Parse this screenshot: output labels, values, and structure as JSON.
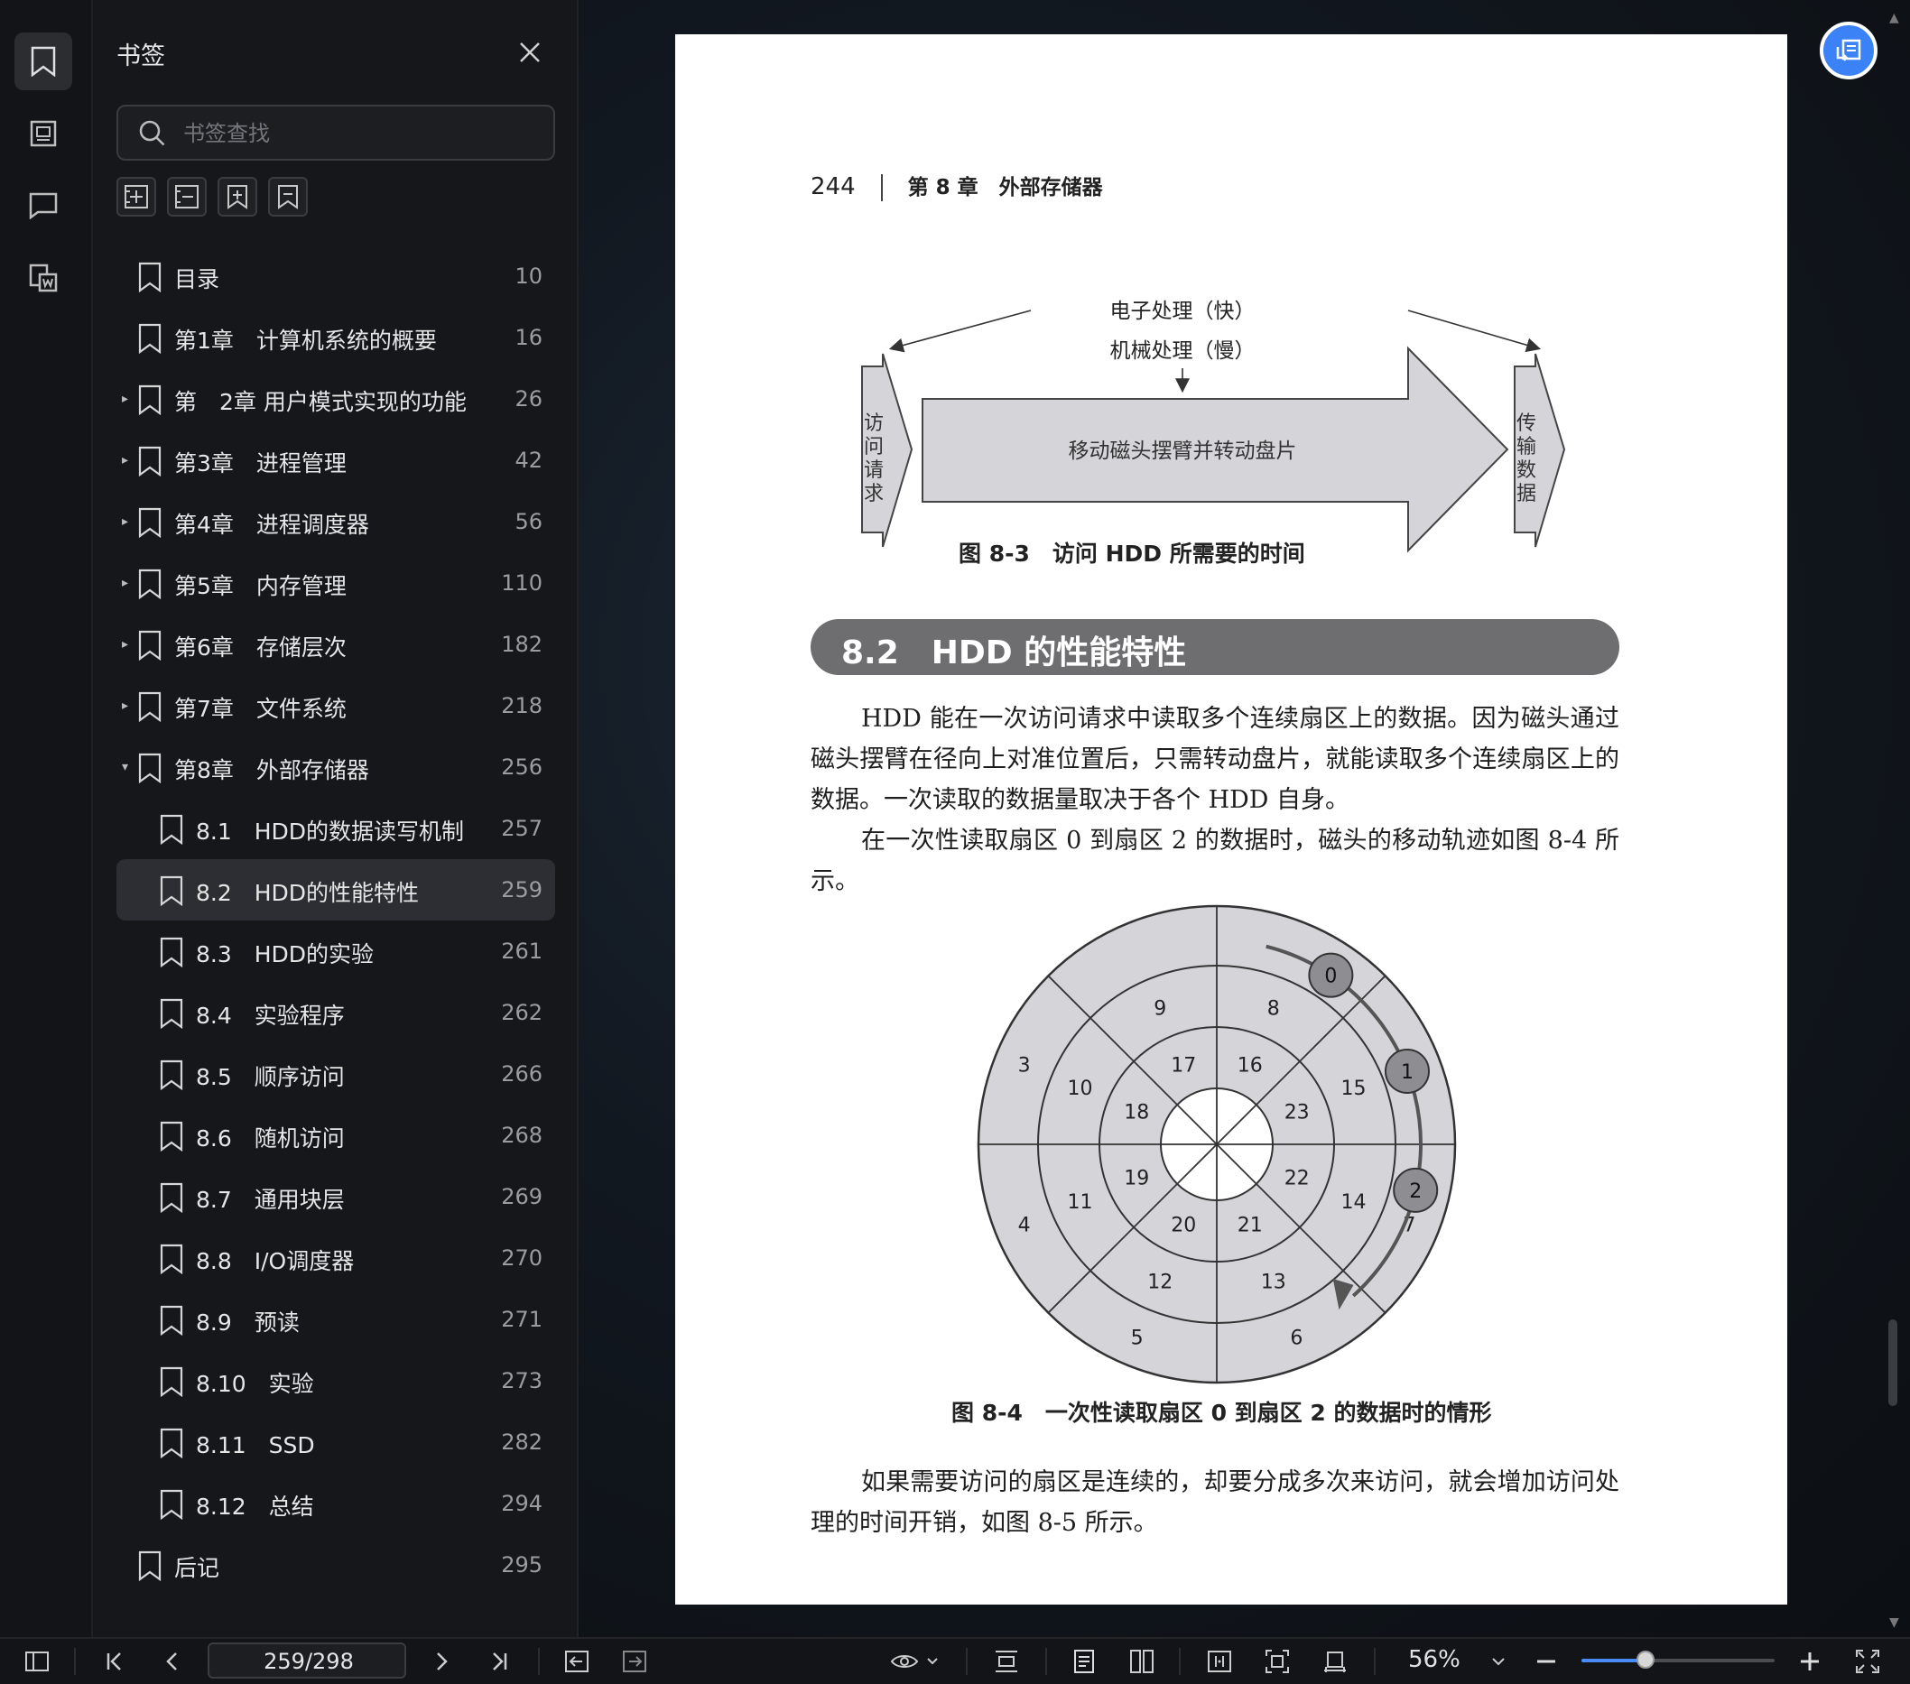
{
  "panel": {
    "title": "书签",
    "search_placeholder": "书签查找"
  },
  "bookmarks": [
    {
      "label": "目录",
      "page": "10",
      "level": 0,
      "arrow": ""
    },
    {
      "label": "第1章　计算机系统的概要",
      "page": "16",
      "level": 0,
      "arrow": ""
    },
    {
      "label": "第　2章 用户模式实现的功能",
      "page": "26",
      "level": 0,
      "arrow": "▸"
    },
    {
      "label": "第3章　进程管理",
      "page": "42",
      "level": 0,
      "arrow": "▸"
    },
    {
      "label": "第4章　进程调度器",
      "page": "56",
      "level": 0,
      "arrow": "▸"
    },
    {
      "label": "第5章　内存管理",
      "page": "110",
      "level": 0,
      "arrow": "▸"
    },
    {
      "label": "第6章　存储层次",
      "page": "182",
      "level": 0,
      "arrow": "▸"
    },
    {
      "label": "第7章　文件系统",
      "page": "218",
      "level": 0,
      "arrow": "▸"
    },
    {
      "label": "第8章　外部存储器",
      "page": "256",
      "level": 0,
      "arrow": "▾"
    },
    {
      "label": "8.1　HDD的数据读写机制",
      "page": "257",
      "level": 1,
      "arrow": ""
    },
    {
      "label": "8.2　HDD的性能特性",
      "page": "259",
      "level": 1,
      "arrow": "",
      "selected": true
    },
    {
      "label": "8.3　HDD的实验",
      "page": "261",
      "level": 1,
      "arrow": ""
    },
    {
      "label": "8.4　实验程序",
      "page": "262",
      "level": 1,
      "arrow": ""
    },
    {
      "label": "8.5　顺序访问",
      "page": "266",
      "level": 1,
      "arrow": ""
    },
    {
      "label": "8.6　随机访问",
      "page": "268",
      "level": 1,
      "arrow": ""
    },
    {
      "label": "8.7　通用块层",
      "page": "269",
      "level": 1,
      "arrow": ""
    },
    {
      "label": "8.8　I/O调度器",
      "page": "270",
      "level": 1,
      "arrow": ""
    },
    {
      "label": "8.9　预读",
      "page": "271",
      "level": 1,
      "arrow": ""
    },
    {
      "label": "8.10　实验",
      "page": "273",
      "level": 1,
      "arrow": ""
    },
    {
      "label": "8.11　SSD",
      "page": "282",
      "level": 1,
      "arrow": ""
    },
    {
      "label": "8.12　总结",
      "page": "294",
      "level": 1,
      "arrow": ""
    },
    {
      "label": "后记",
      "page": "295",
      "level": 0,
      "arrow": ""
    }
  ],
  "page": {
    "number": "244",
    "chapter": "第 8 章　外部存储器",
    "fig3": {
      "top_label": "电子处理（快）",
      "mid_label": "机械处理（慢）",
      "left_label": "访问请求",
      "center_label": "移动磁头摆臂并转动盘片",
      "right_label": "传输数据",
      "caption": "图 8-3　访问 HDD 所需要的时间"
    },
    "section": "8.2　HDD 的性能特性",
    "para1": "HDD 能在一次访问请求中读取多个连续扇区上的数据。因为磁头通过磁头摆臂在径向上对准位置后，只需转动盘片，就能读取多个连续扇区上的数据。一次读取的数据量取决于各个 HDD 自身。",
    "para2": "在一次性读取扇区 0 到扇区 2 的数据时，磁头的移动轨迹如图 8-4 所示。",
    "fig4": {
      "sectors": [
        "0",
        "1",
        "2",
        "3",
        "4",
        "5",
        "6",
        "7",
        "8",
        "9",
        "10",
        "11",
        "12",
        "13",
        "14",
        "15",
        "16",
        "17",
        "18",
        "19",
        "20",
        "21",
        "22",
        "23"
      ],
      "caption": "图 8-4　一次性读取扇区 0 到扇区 2 的数据时的情形"
    },
    "para3": "如果需要访问的扇区是连续的，却要分成多次来访问，就会增加访问处理的时间开销，如图 8-5 所示。"
  },
  "toolbar": {
    "page_indicator": "259/298",
    "zoom": "56%",
    "zoom_fraction": 0.33
  },
  "colors": {
    "accent": "#3b82f6",
    "panel_bg": "#15171b",
    "selected_bg": "#2c2e33",
    "section_bar": "#6e6e70",
    "figure_fill": "#d5d5d9"
  }
}
